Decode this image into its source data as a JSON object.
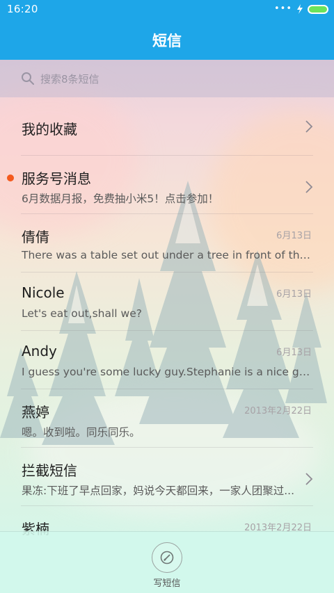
{
  "status_bar": {
    "time": "16:20",
    "dots": "•••",
    "battery_color": "#6be35c"
  },
  "header": {
    "title": "短信",
    "bar_color": "#1ea6e8"
  },
  "search": {
    "placeholder": "搜索8条短信"
  },
  "conversations": [
    {
      "title": "我的收藏",
      "subtitle": "",
      "date": "",
      "has_chevron": true,
      "unread": false
    },
    {
      "title": "服务号消息",
      "subtitle": "6月数据月报，免费抽小米5！点击参加！",
      "date": "",
      "has_chevron": true,
      "unread": true,
      "unread_color": "#f45a1e"
    },
    {
      "title": "倩倩",
      "subtitle": "There was a table set out under a tree in front of the ho...",
      "date": "6月13日",
      "has_chevron": false,
      "unread": false
    },
    {
      "title": "Nicole",
      "subtitle": "Let's eat out,shall we?",
      "date": "6月13日",
      "has_chevron": false,
      "unread": false
    },
    {
      "title": "Andy",
      "subtitle": "I guess you're some lucky guy.Stephanie is a nice girl.",
      "date": "6月13日",
      "has_chevron": false,
      "unread": false
    },
    {
      "title": "燕婷",
      "subtitle": "嗯。收到啦。同乐同乐。",
      "date": "2013年2月22日",
      "has_chevron": false,
      "unread": false
    },
    {
      "title": "拦截短信",
      "subtitle": "果冻:下班了早点回家，妈说今天都回来，一家人团聚过...",
      "date": "",
      "has_chevron": true,
      "unread": false
    },
    {
      "title": "紫楠",
      "subtitle": "",
      "date": "2013年2月22日",
      "has_chevron": false,
      "unread": false
    }
  ],
  "bottom_bar": {
    "compose_label": "写短信",
    "compose_icon": "pencil-circle-icon"
  }
}
